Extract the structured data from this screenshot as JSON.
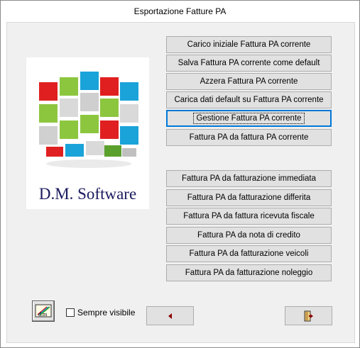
{
  "window": {
    "title": "Esportazione Fatture PA"
  },
  "buttons_top": [
    {
      "label": "Carico iniziale Fattura PA corrente"
    },
    {
      "label": "Salva Fattura PA corrente come default"
    },
    {
      "label": "Azzera Fattura PA corrente"
    },
    {
      "label": "Carica dati default su Fattura PA corrente"
    },
    {
      "label": "Gestione Fattura PA corrente"
    },
    {
      "label": "Fattura PA da fattura PA corrente"
    }
  ],
  "buttons_bottom": [
    {
      "label": "Fattura PA da fatturazione immediata"
    },
    {
      "label": "Fattura PA da fatturazione differita"
    },
    {
      "label": "Fattura PA da fattura ricevuta fiscale"
    },
    {
      "label": "Fattura PA da nota di credito"
    },
    {
      "label": "Fattura PA da fatturazione veicoli"
    },
    {
      "label": "Fattura PA da fatturazione noleggio"
    }
  ],
  "logo": {
    "text": "D.M. Software"
  },
  "footer": {
    "always_visible_label": "Sempre visibile",
    "always_visible_checked": false,
    "icons": {
      "tool": "edit-tool-icon",
      "back": "back-arrow-icon",
      "exit": "exit-door-icon"
    }
  },
  "colors": {
    "accent": "#0078d7",
    "button_bg": "#e1e1e1",
    "panel_bg": "#f0f0f0",
    "arrow": "#8b0000"
  }
}
